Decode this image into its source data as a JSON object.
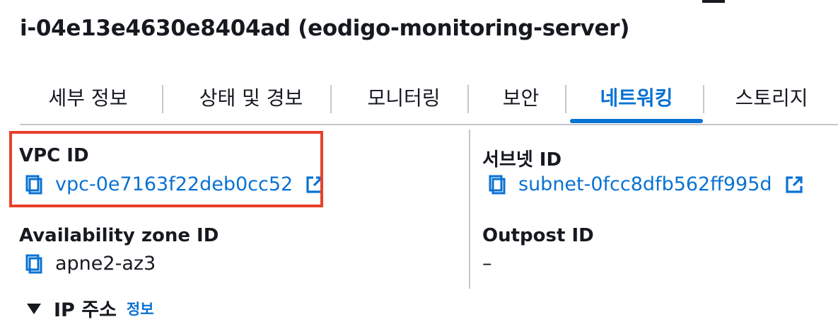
{
  "page": {
    "title": "i-04e13e4630e8404ad (eodigo-monitoring-server)"
  },
  "tabs": [
    {
      "label": "세부 정보",
      "active": false
    },
    {
      "label": "상태 및 경보",
      "active": false
    },
    {
      "label": "모니터링",
      "active": false
    },
    {
      "label": "보안",
      "active": false
    },
    {
      "label": "네트워킹",
      "active": true
    },
    {
      "label": "스토리지",
      "active": false
    }
  ],
  "fields": {
    "vpc_id": {
      "label": "VPC ID",
      "value": "vpc-0e7163f22deb0cc52",
      "icon": "copy-icon",
      "link_icon": "external-link-icon"
    },
    "subnet_id": {
      "label": "서브넷 ID",
      "value": "subnet-0fcc8dfb562ff995d",
      "icon": "copy-icon",
      "link_icon": "external-link-icon"
    },
    "availability_zone_id": {
      "label": "Availability zone ID",
      "value": "apne2-az3",
      "icon": "copy-icon"
    },
    "outpost_id": {
      "label": "Outpost ID",
      "value": "–"
    }
  },
  "ip_section": {
    "title": "IP 주소",
    "info_link": "정보",
    "expanded": true
  },
  "colors": {
    "accent": "#0972d3",
    "text": "#16191f",
    "divider": "#c6c6cd",
    "highlight": "#e8402a"
  }
}
